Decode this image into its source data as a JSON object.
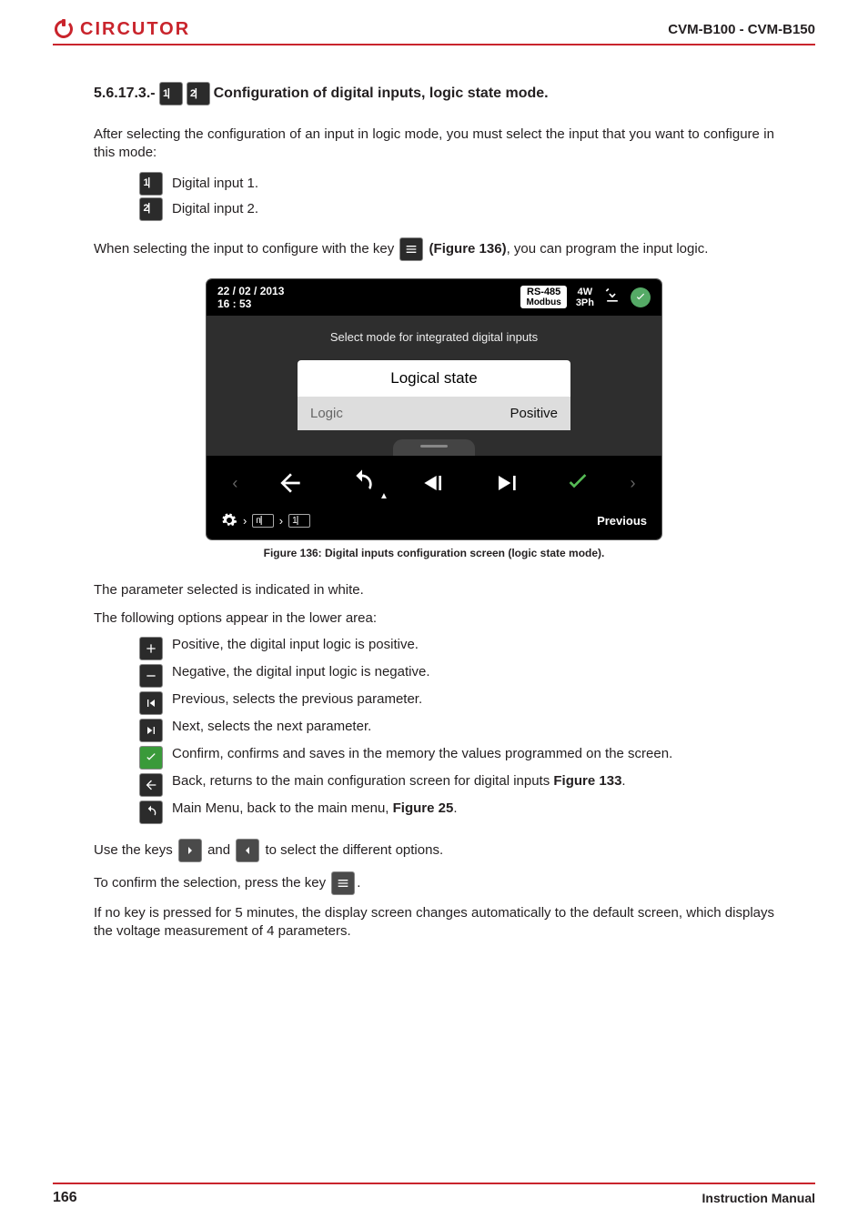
{
  "header": {
    "brand": "CIRCUTOR",
    "model": "CVM-B100 - CVM-B150"
  },
  "section": {
    "number": "5.6.17.3.-",
    "title": "Configuration of digital inputs, logic state mode."
  },
  "para1": "After selecting the configuration of an input in logic mode, you must select the input that you want to configure in this mode:",
  "di": {
    "one": "Digital input 1.",
    "two": "Digital input 2."
  },
  "para2a": "When selecting the input to configure with the key",
  "para2_figref": "(Figure 136)",
  "para2b": ", you can program the input logic.",
  "device": {
    "date": "22 / 02 / 2013",
    "time": "16 : 53",
    "comm1": "RS-485",
    "comm2": "Modbus",
    "wire1": "4W",
    "wire2": "3Ph",
    "prompt": "Select mode for integrated digital inputs",
    "tab": "Logical state",
    "row_label": "Logic",
    "row_value": "Positive",
    "foot_right": "Previous"
  },
  "figcaption": "Figure 136: Digital inputs configuration screen (logic state mode).",
  "para3": "The parameter selected is indicated in white.",
  "para4": "The following options appear in the lower area:",
  "options": {
    "positive": "Positive, the digital input logic is positive.",
    "negative": "Negative, the digital input logic is negative.",
    "previous": "Previous, selects the previous parameter.",
    "next": "Next, selects the next parameter.",
    "confirm": "Confirm, confirms and saves in the memory the values programmed on the screen.",
    "back_a": "Back, returns to the main configuration screen for digital inputs ",
    "back_ref": "Figure 133",
    "back_b": ".",
    "menu_a": "Main Menu, back to the main menu, ",
    "menu_ref": "Figure 25",
    "menu_b": "."
  },
  "para5a": "Use the keys",
  "para5b": "and",
  "para5c": "to select the different options.",
  "para6a": "To confirm the selection, press the key",
  "para6b": ".",
  "para7": "If no key is pressed for 5 minutes, the display screen changes automatically to the default screen, which displays the voltage measurement of 4 parameters.",
  "footer": {
    "page": "166",
    "manual": "Instruction Manual"
  }
}
